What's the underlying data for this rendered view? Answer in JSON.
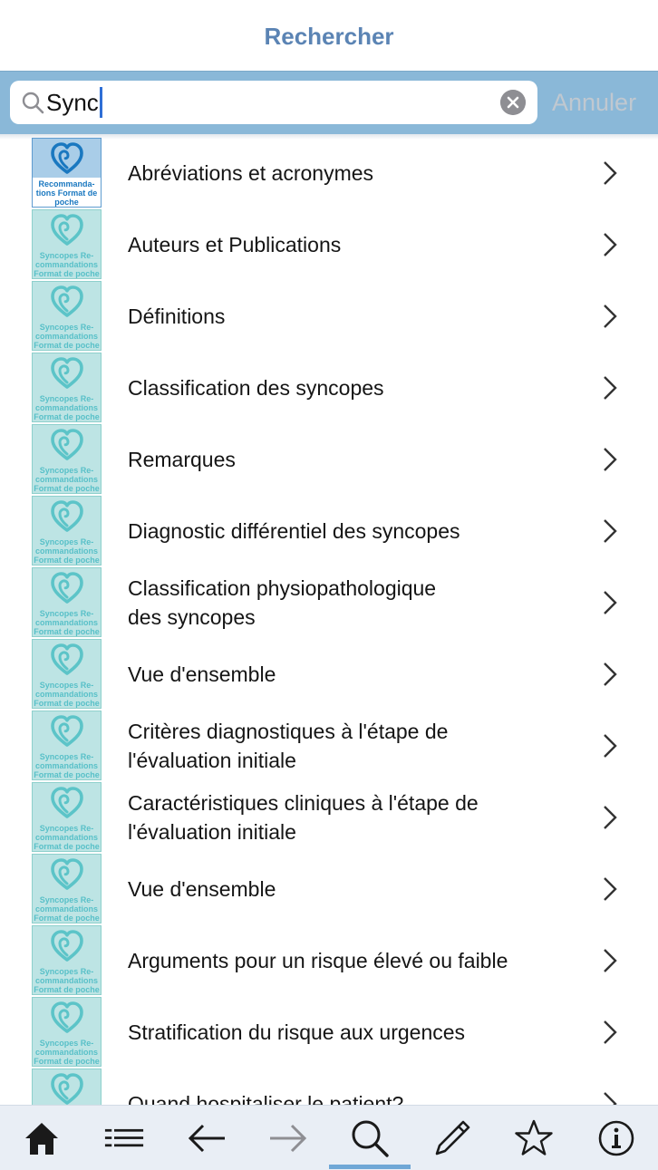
{
  "header": {
    "title": "Rechercher"
  },
  "search": {
    "query": "Sync",
    "cancel_label": "Annuler"
  },
  "thumbnails": {
    "first_caption": "Recommanda-\ntions Format de\npoche",
    "default_caption": "Syncopes Re-\ncommandations\nFormat de poche"
  },
  "results": [
    {
      "label": "Abréviations et acronymes"
    },
    {
      "label": "Auteurs et Publications"
    },
    {
      "label": "Définitions"
    },
    {
      "label": "Classification des syncopes"
    },
    {
      "label": "Remarques"
    },
    {
      "label": "Diagnostic différentiel des syncopes"
    },
    {
      "label": "Classification physiopathologique\ndes syncopes"
    },
    {
      "label": "Vue d'ensemble"
    },
    {
      "label": "Critères diagnostiques à l'étape de\nl'évaluation initiale"
    },
    {
      "label": "Caractéristiques cliniques à l'étape de\nl'évaluation initiale"
    },
    {
      "label": "Vue d'ensemble"
    },
    {
      "label": "Arguments pour un risque élevé ou faible"
    },
    {
      "label": "Stratification du risque aux urgences"
    },
    {
      "label": "Quand hospitaliser le patient?"
    }
  ],
  "tabbar": {
    "tabs": [
      {
        "icon": "home-icon"
      },
      {
        "icon": "list-icon"
      },
      {
        "icon": "back-arrow-icon"
      },
      {
        "icon": "forward-arrow-icon"
      },
      {
        "icon": "search-icon",
        "active": true
      },
      {
        "icon": "pencil-icon"
      },
      {
        "icon": "star-icon"
      },
      {
        "icon": "info-icon"
      }
    ]
  },
  "colors": {
    "accent": "#5b84b4",
    "searchbar": "#8ab8d8",
    "tab_indicator": "#6fa7d6",
    "thumbnail_teal": "#bde4e4"
  }
}
